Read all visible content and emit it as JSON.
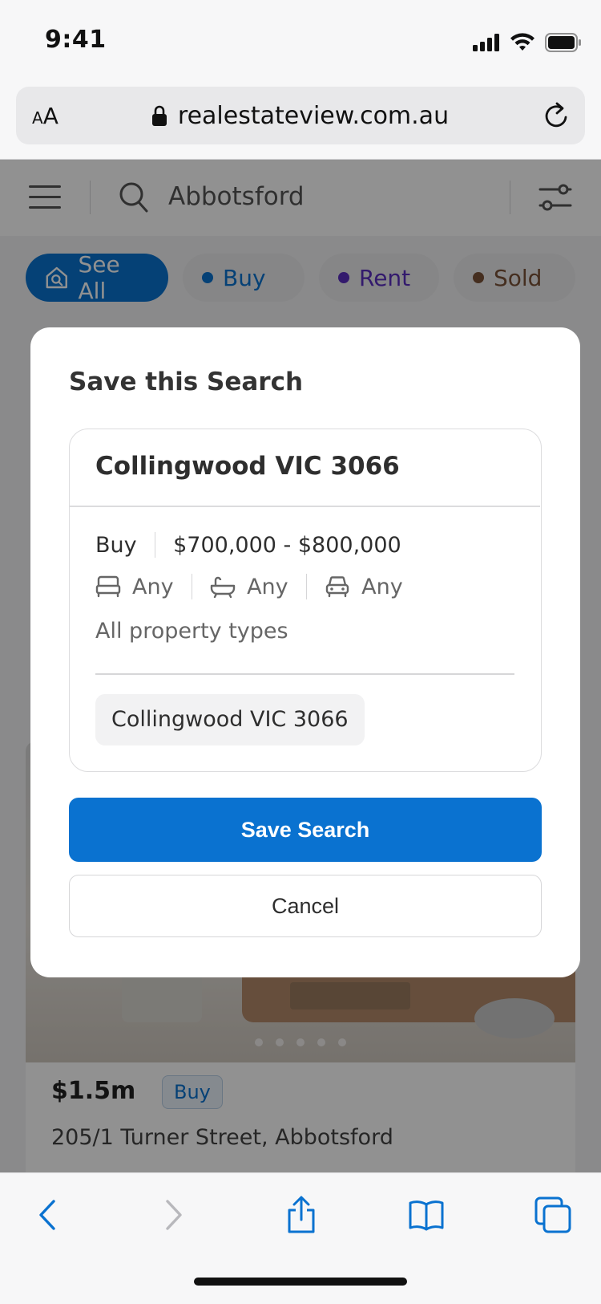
{
  "status_bar": {
    "time": "9:41"
  },
  "browser": {
    "text_size_label_small": "A",
    "text_size_label_large": "A",
    "url": "realestateview.com.au"
  },
  "app": {
    "search_query": "Abbotsford",
    "filter_chips": [
      {
        "label": "See All",
        "color": "#0a72d0"
      },
      {
        "label": "Buy",
        "color": "#0a72d0"
      },
      {
        "label": "Rent",
        "color": "#5b2ec0"
      },
      {
        "label": "Sold",
        "color": "#7a5238"
      }
    ],
    "listing": {
      "price": "$1.5m",
      "badge": "Buy",
      "address": "205/1 Turner Street, Abbotsford"
    }
  },
  "modal": {
    "title": "Save this Search",
    "summary": {
      "location_title": "Collingwood VIC 3066",
      "listing_type": "Buy",
      "price_range": "$700,000 - $800,000",
      "bedrooms": "Any",
      "bathrooms": "Any",
      "parking": "Any",
      "property_types": "All property types",
      "location_chip": "Collingwood VIC 3066"
    },
    "save_label": "Save Search",
    "cancel_label": "Cancel"
  },
  "colors": {
    "brand_blue": "#0a72d0"
  }
}
